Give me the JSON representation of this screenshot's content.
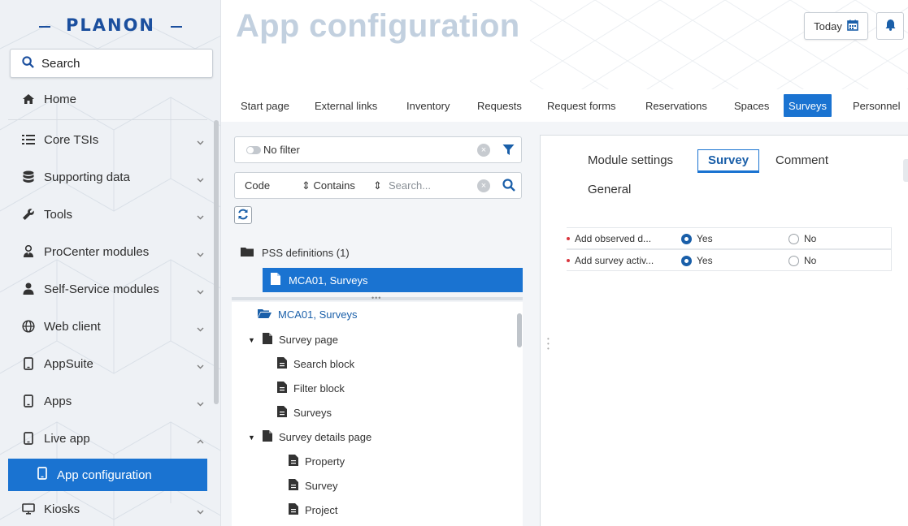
{
  "brand": {
    "logo_text": "PLANON"
  },
  "sidebar": {
    "search_label": "Search",
    "items": [
      {
        "label": "Home",
        "icon": "home-icon"
      },
      {
        "label": "Core TSIs",
        "icon": "list-icon"
      },
      {
        "label": "Supporting data",
        "icon": "database-icon"
      },
      {
        "label": "Tools",
        "icon": "wrench-icon"
      },
      {
        "label": "ProCenter modules",
        "icon": "user-tie-icon"
      },
      {
        "label": "Self-Service modules",
        "icon": "user-icon"
      },
      {
        "label": "Web client",
        "icon": "globe-icon"
      },
      {
        "label": "AppSuite",
        "icon": "mobile-icon"
      },
      {
        "label": "Apps",
        "icon": "mobile-icon"
      },
      {
        "label": "Live app",
        "icon": "mobile-icon"
      },
      {
        "label": "App configuration",
        "icon": "mobile-icon",
        "active": true
      },
      {
        "label": "Kiosks",
        "icon": "monitor-icon"
      }
    ]
  },
  "header": {
    "title": "App configuration",
    "today_label": "Today"
  },
  "tabs": [
    {
      "label": "Start page"
    },
    {
      "label": "External links"
    },
    {
      "label": "Inventory"
    },
    {
      "label": "Requests"
    },
    {
      "label": "Request forms"
    },
    {
      "label": "Reservations"
    },
    {
      "label": "Spaces"
    },
    {
      "label": "Surveys",
      "active": true
    },
    {
      "label": "Personnel"
    }
  ],
  "left_panel": {
    "filter_label": "No filter",
    "search": {
      "field": "Code",
      "operator": "Contains",
      "placeholder": "Search..."
    },
    "tree_root": "PSS definitions (1)",
    "selected_item": "MCA01, Surveys",
    "tree": {
      "root": "MCA01, Surveys",
      "nodes": [
        {
          "label": "Survey page",
          "expanded": true
        },
        {
          "label": "Search block"
        },
        {
          "label": "Filter block"
        },
        {
          "label": "Surveys"
        },
        {
          "label": "Survey details page",
          "expanded": true
        },
        {
          "label": "Property"
        },
        {
          "label": "Survey"
        },
        {
          "label": "Project"
        }
      ]
    }
  },
  "right_panel": {
    "tabs": [
      {
        "label": "Module settings"
      },
      {
        "label": "Survey",
        "active": true
      },
      {
        "label": "Comment"
      },
      {
        "label": "General"
      }
    ],
    "fields": [
      {
        "label": "Add observed d...",
        "yes": "Yes",
        "no": "No",
        "value": "Yes"
      },
      {
        "label": "Add survey activ...",
        "yes": "Yes",
        "no": "No",
        "value": "Yes"
      }
    ]
  },
  "colors": {
    "accent": "#1a73d1",
    "title": "#c2d0df",
    "required": "#d9363e"
  }
}
